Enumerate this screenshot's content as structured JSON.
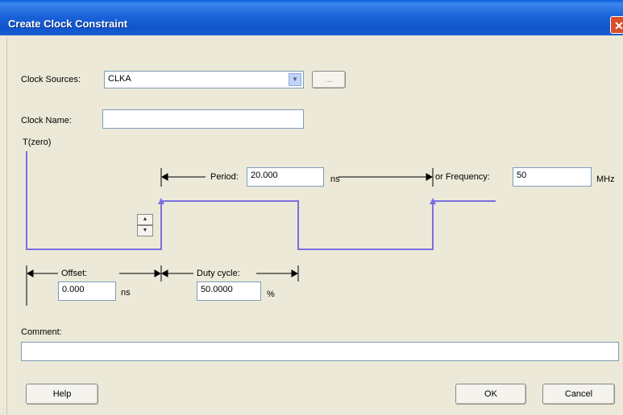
{
  "window": {
    "title": "Create Clock Constraint",
    "close_glyph": "✕"
  },
  "clock_sources": {
    "label": "Clock Sources:",
    "value": "CLKA",
    "browse_label": "..."
  },
  "clock_name": {
    "label": "Clock Name:",
    "value": ""
  },
  "waveform": {
    "t_zero_label": "T(zero)",
    "period_label": "Period:",
    "period_value": "20.000",
    "period_unit": "ns",
    "frequency_label": "or Frequency:",
    "frequency_value": "50",
    "frequency_unit": "MHz",
    "offset_label": "Offset:",
    "offset_value": "0.000",
    "offset_unit": "ns",
    "duty_label": "Duty cycle:",
    "duty_value": "50.0000",
    "duty_unit": "%",
    "spin_up": "▲",
    "spin_down": "▼",
    "line_color": "#7b6fe0"
  },
  "comment": {
    "label": "Comment:",
    "value": ""
  },
  "buttons": {
    "help": "Help",
    "ok": "OK",
    "cancel": "Cancel"
  }
}
